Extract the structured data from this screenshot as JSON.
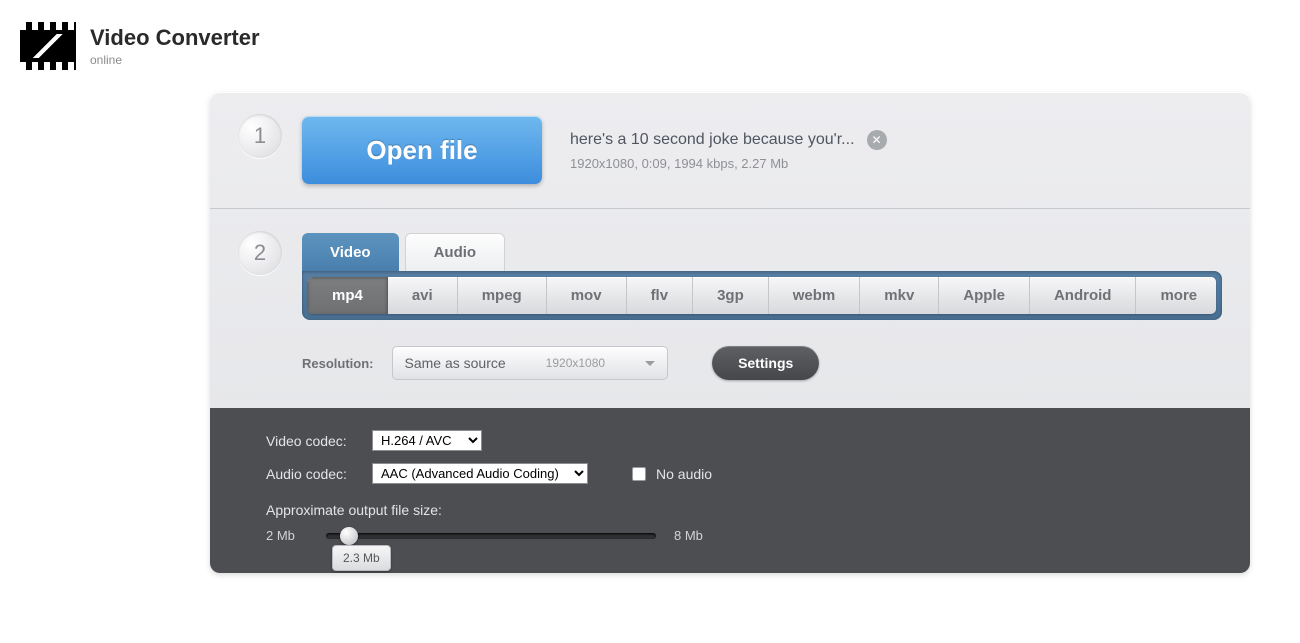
{
  "brand": {
    "title": "Video Converter",
    "subtitle": "online"
  },
  "step1": {
    "number": "1",
    "open_label": "Open file",
    "file_name": "here's a 10 second joke because you'r...",
    "file_meta": "1920x1080, 0:09, 1994 kbps, 2.27 Mb"
  },
  "step2": {
    "number": "2",
    "tabs": {
      "video": "Video",
      "audio": "Audio"
    },
    "formats": [
      "mp4",
      "avi",
      "mpeg",
      "mov",
      "flv",
      "3gp",
      "webm",
      "mkv",
      "Apple",
      "Android",
      "more"
    ],
    "resolution": {
      "label": "Resolution:",
      "value": "Same as source",
      "dim": "1920x1080"
    },
    "settings_label": "Settings"
  },
  "adv": {
    "video_codec_label": "Video codec:",
    "video_codec": "H.264 / AVC",
    "audio_codec_label": "Audio codec:",
    "audio_codec": "AAC (Advanced Audio Coding)",
    "no_audio_label": "No audio",
    "size_title": "Approximate output file size:",
    "size_min": "2 Mb",
    "size_max": "8 Mb",
    "size_value": "2.3 Mb"
  }
}
